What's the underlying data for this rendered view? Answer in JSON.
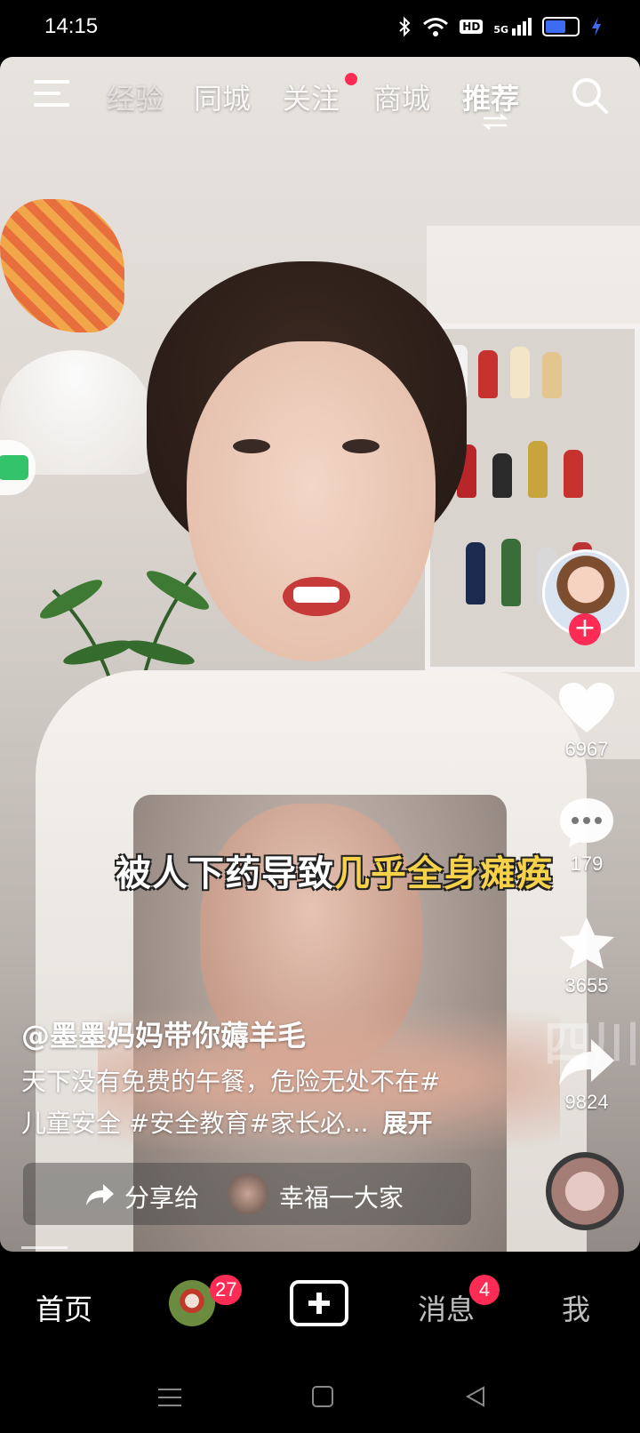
{
  "status_bar": {
    "time": "14:15",
    "icons": [
      "bluetooth-icon",
      "wifi-icon",
      "hd-icon",
      "signal-5g-icon",
      "battery-icon",
      "charging-icon"
    ],
    "hd_label": "HD",
    "network_label": "5G"
  },
  "top_nav": {
    "tabs": [
      {
        "label": "经验"
      },
      {
        "label": "同城"
      },
      {
        "label": "关注",
        "has_dot": true
      },
      {
        "label": "商城"
      },
      {
        "label": "推荐",
        "active": true
      }
    ]
  },
  "video": {
    "caption_white": "被人下药导致",
    "caption_yellow": "几乎全身瘫痪",
    "watermark": "四川"
  },
  "actions": {
    "likes": "6967",
    "comments": "179",
    "favorites": "3655",
    "shares": "9824"
  },
  "post": {
    "author": "@墨墨妈妈带你薅羊毛",
    "desc_line1": "天下没有免费的午餐，危险无处不在#",
    "desc_line2": "儿童安全 #安全教育#家长必...",
    "expand_label": "展开"
  },
  "share_bar": {
    "label": "分享给",
    "friend_name": "幸福一大家"
  },
  "bottom_nav": {
    "home": "首页",
    "friends_badge": "27",
    "messages": "消息",
    "messages_badge": "4",
    "me": "我"
  },
  "colors": {
    "accent": "#fe2c55",
    "caption_yellow": "#f6d24a"
  }
}
